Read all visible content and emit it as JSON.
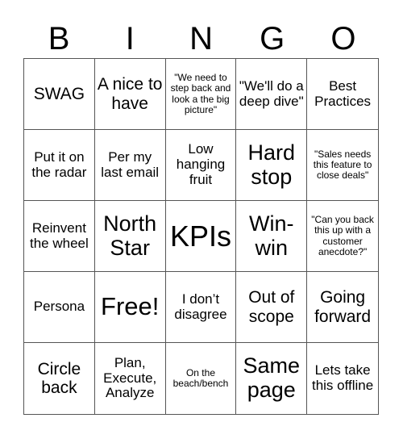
{
  "header": [
    "B",
    "I",
    "N",
    "G",
    "O"
  ],
  "cells": [
    "SWAG",
    "A nice to have",
    "\"We need to step back and look a the big picture\"",
    "\"We'll do a deep dive\"",
    "Best Practices",
    "Put it on the radar",
    "Per my last email",
    "Low hanging fruit",
    "Hard stop",
    "\"Sales needs this feature to close deals\"",
    "Reinvent the wheel",
    "North Star",
    "KPIs",
    "Win-win",
    "\"Can you back this up with a customer anecdote?\"",
    "Persona",
    "Free!",
    "I don’t disagree",
    "Out of scope",
    "Going forward",
    "Circle back",
    "Plan, Execute, Analyze",
    "On the beach/bench",
    "Same page",
    "Lets take this offline"
  ]
}
